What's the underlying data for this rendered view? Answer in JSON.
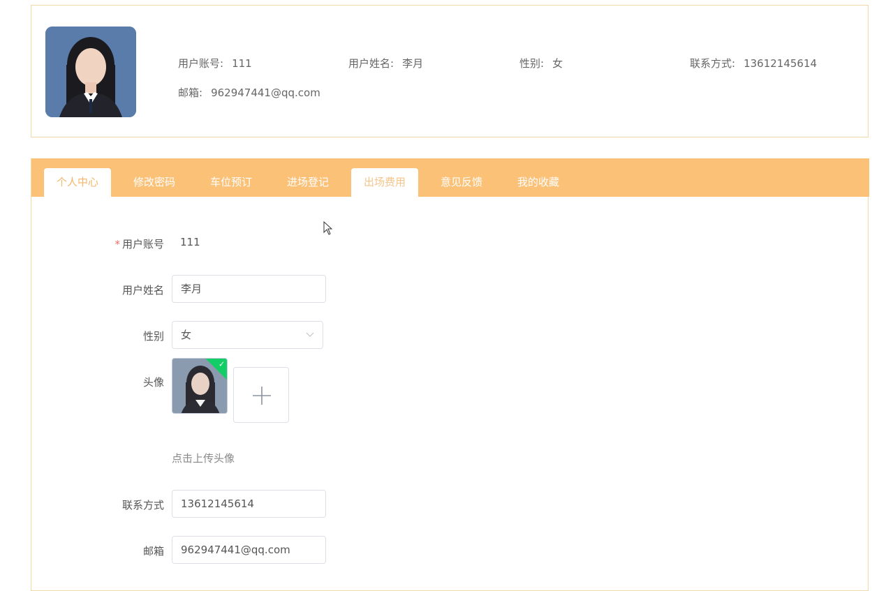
{
  "profile": {
    "account_label": "用户账号:",
    "account_value": "111",
    "name_label": "用户姓名:",
    "name_value": "李月",
    "gender_label": "性别:",
    "gender_value": "女",
    "phone_label": "联系方式:",
    "phone_value": "13612145614",
    "email_label": "邮箱:",
    "email_value": "962947441@qq.com"
  },
  "tabs": [
    {
      "label": "个人中心",
      "active": true
    },
    {
      "label": "修改密码",
      "active": false
    },
    {
      "label": "车位预订",
      "active": false
    },
    {
      "label": "进场登记",
      "active": false
    },
    {
      "label": "出场费用",
      "active": true
    },
    {
      "label": "意见反馈",
      "active": false
    },
    {
      "label": "我的收藏",
      "active": false
    }
  ],
  "form": {
    "required_mark": "*",
    "account_label": "用户账号",
    "account_value": "111",
    "name_label": "用户姓名",
    "name_value": "李月",
    "gender_label": "性别",
    "gender_value": "女",
    "avatar_label": "头像",
    "upload_tip": "点击上传头像",
    "phone_label": "联系方式",
    "phone_value": "13612145614",
    "email_label": "邮箱",
    "email_value": "962947441@qq.com"
  },
  "colors": {
    "accent": "#fbc177",
    "border": "#f3d9a8",
    "success": "#13ce66"
  }
}
